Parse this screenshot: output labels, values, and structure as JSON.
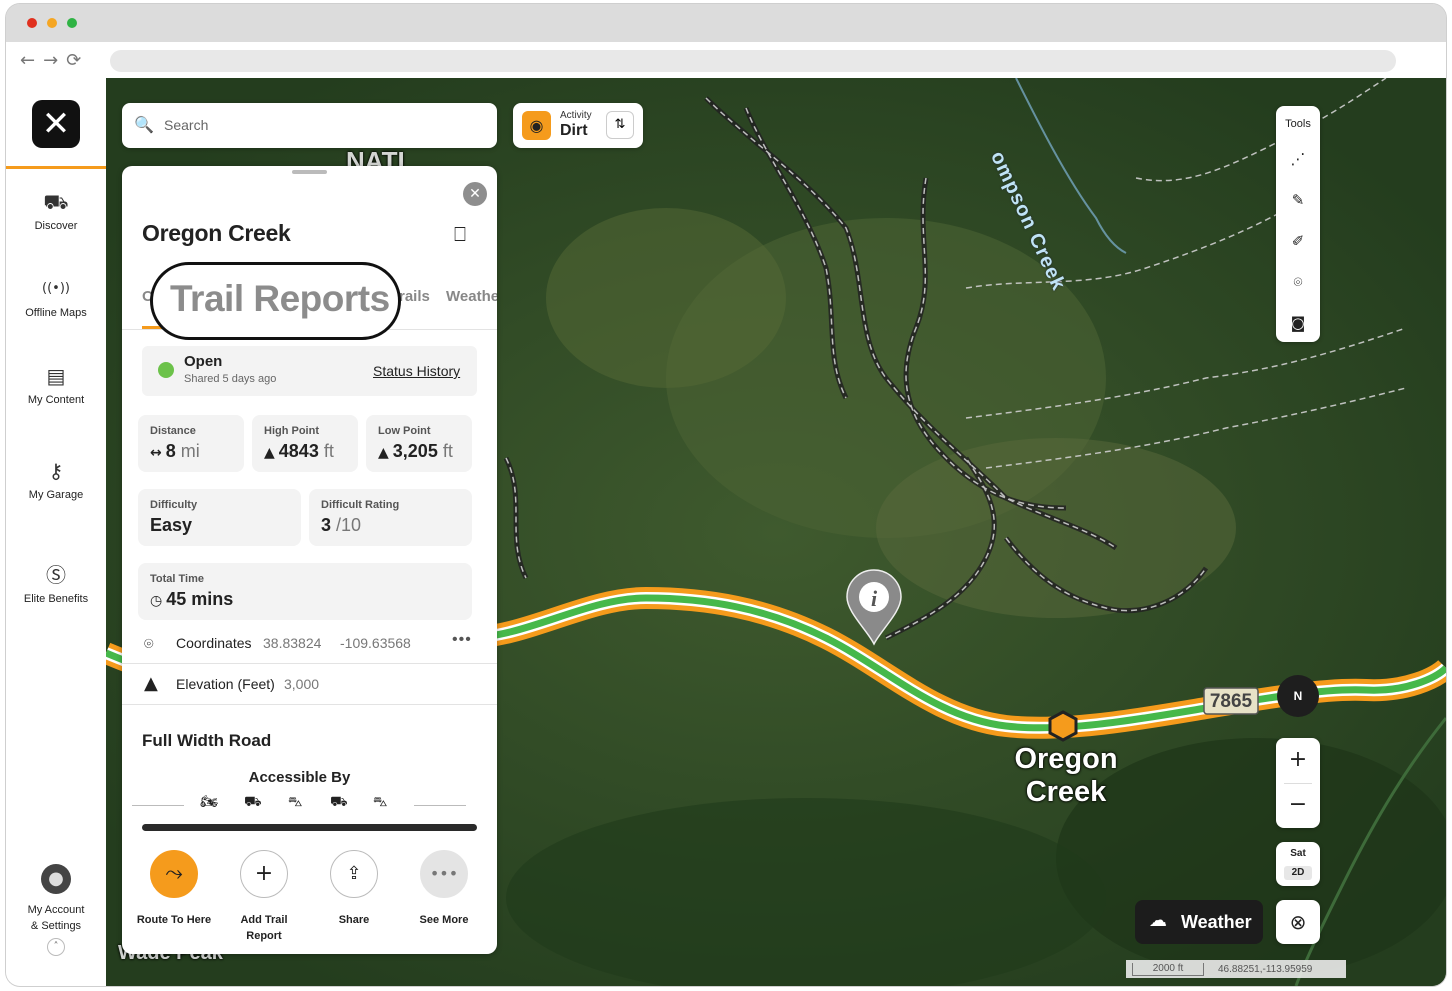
{
  "browser": {
    "title_dots": [
      "#e0301e",
      "#f5a623",
      "#2fb344"
    ]
  },
  "sidebar": {
    "items": [
      {
        "label": "Discover",
        "icon": "discover-icon"
      },
      {
        "label": "Offline Maps",
        "icon": "offline-maps-icon"
      },
      {
        "label": "My Content",
        "icon": "my-content-icon"
      },
      {
        "label": "My Garage",
        "icon": "garage-icon"
      },
      {
        "label": "Elite Benefits",
        "icon": "dollar-icon"
      }
    ],
    "account": {
      "line1": "My Account",
      "line2": "& Settings"
    }
  },
  "search": {
    "placeholder": "Search"
  },
  "activity": {
    "label": "Activity",
    "value": "Dirt"
  },
  "panel": {
    "title": "Oregon Creek",
    "highlight_text": "Trail Reports",
    "tabs": [
      "O",
      "Trail Reports",
      "Trails",
      "Weather"
    ],
    "tab_partial": {
      "left": "O",
      "trails": "rails",
      "weather": "Weathe"
    },
    "status": {
      "state": "Open",
      "shared": "Shared 5 days ago",
      "history_link": "Status History"
    },
    "stats": {
      "distance": {
        "label": "Distance",
        "value": "8",
        "unit": "mi"
      },
      "high_point": {
        "label": "High Point",
        "value": "4843",
        "unit": "ft"
      },
      "low_point": {
        "label": "Low Point",
        "value": "3,205",
        "unit": "ft"
      },
      "difficulty": {
        "label": "Difficulty",
        "value": "Easy"
      },
      "difficulty_rating": {
        "label": "Difficult Rating",
        "value": "3",
        "unit": "/10"
      },
      "total_time": {
        "label": "Total Time",
        "value": "45",
        "unit": "mins"
      }
    },
    "coordinates": {
      "label": "Coordinates",
      "lat": "38.83824",
      "lon": "-109.63568"
    },
    "elevation": {
      "label": "Elevation (Feet)",
      "value": "3,000"
    },
    "road_type": "Full Width Road",
    "accessible_by": "Accessible By",
    "vehicles": [
      "dirt-bike-icon",
      "atv-icon",
      "side-by-side-icon",
      "utv-icon",
      "4x4-icon"
    ],
    "actions": [
      {
        "label": "Route To Here"
      },
      {
        "label": "Add Trail Report"
      },
      {
        "label": "Share"
      },
      {
        "label": "See More"
      }
    ]
  },
  "map": {
    "labels": {
      "creek": "ompson Creek",
      "road_number": "7865",
      "place_line1": "Oregon",
      "place_line2": "Creek",
      "top": "NATI",
      "bottom": "Wade Peak"
    },
    "tools_title": "Tools",
    "compass": "N",
    "layer": {
      "type": "Sat",
      "mode": "2D"
    },
    "weather_label": "Weather",
    "scale": "2000 ft",
    "cursor_coords": "46.88251,-113.95959",
    "accent_color": "#f59b1c",
    "status_open_color": "#6cc24a"
  }
}
